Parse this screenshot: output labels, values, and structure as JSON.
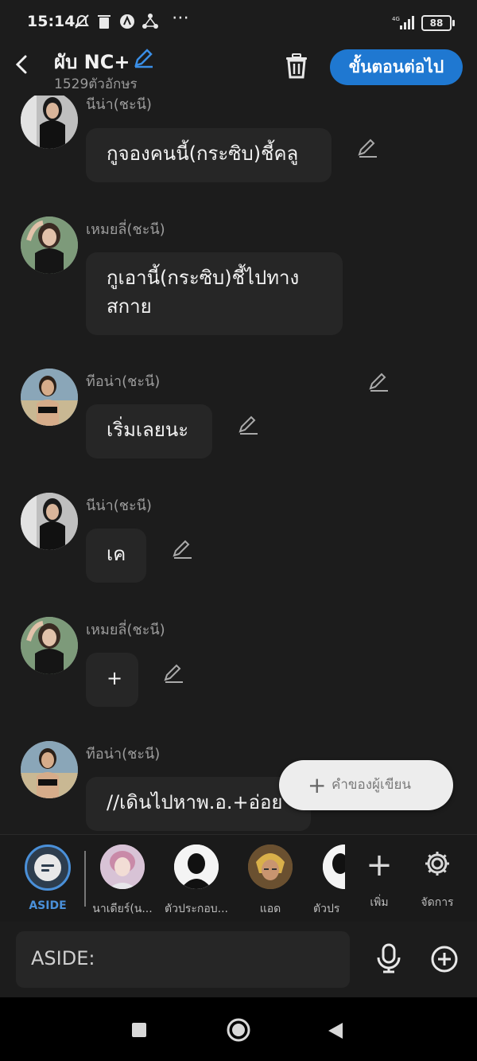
{
  "status": {
    "time": "15:14",
    "battery": "88",
    "network": "4G"
  },
  "header": {
    "title": "ผับ NC+",
    "char_count": "1529ตัวอักษร",
    "next_label": "ขั้นตอนต่อไป"
  },
  "messages": [
    {
      "sender": "นีน่า(ชะนี)",
      "text": "กูจองคนนี้(กระซิบ)ชี้คลู"
    },
    {
      "sender": "เหมยลี่(ชะนี)",
      "text_line1": "กูเอานี้(กระซิบ)ชี้ไปทาง",
      "text_line2": "สกาย"
    },
    {
      "sender": "ทีอน่า(ชะนี)",
      "text": "เริ่มเลยนะ"
    },
    {
      "sender": "นีน่า(ชะนี)",
      "text": "เค"
    },
    {
      "sender": "เหมยลี่(ชะนี)",
      "text": "+"
    },
    {
      "sender": "ทีอน่า(ชะนี)",
      "text": "//เดินไปหาพ.อ.+อ่อย"
    }
  ],
  "fab": {
    "label": "คำของผู้เขียน"
  },
  "characters": [
    {
      "name": "ASIDE"
    },
    {
      "name": "นาเดียร์(น..."
    },
    {
      "name": "ตัวประกอบ..."
    },
    {
      "name": "แอด"
    },
    {
      "name": "ตัวปร"
    }
  ],
  "charbar": {
    "add_label": "เพิ่ม",
    "manage_label": "จัดการ"
  },
  "input": {
    "placeholder": "ASIDE:"
  },
  "colors": {
    "accent": "#1f78d1",
    "bg": "#1c1c1c",
    "bubble": "#262626"
  }
}
